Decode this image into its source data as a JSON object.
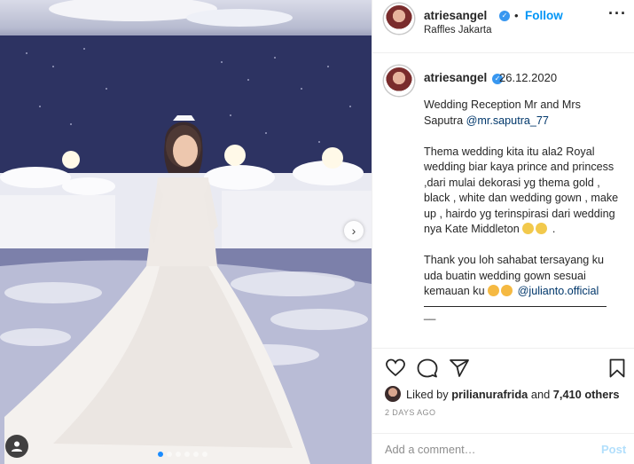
{
  "post": {
    "username": "atriesangel",
    "verified_mark": "✓",
    "follow_label": "Follow",
    "location": "Raffles Jakarta",
    "more_icon": "more-horizontal-icon"
  },
  "caption": {
    "username": "atriesangel",
    "date": "26.12.2020",
    "para1_text": "Wedding Reception Mr and Mrs Saputra ",
    "para1_mention": "@mr.saputra_77",
    "para2_text": "Thema wedding kita itu ala2 Royal wedding biar kaya prince and princess ,dari mulai dekorasi yg thema gold , black , white dan wedding gown , make up , hairdo yg terinspirasi dari wedding nya Kate Middleton ",
    "para2_tail": " .",
    "para3_text": "Thank you loh sahabat tersayang ku uda buatin wedding gown sesuai kemauan ku ",
    "para3_mention": "@julianto.official",
    "rule_tail": "__"
  },
  "actions": {
    "liked_prefix": "Liked by ",
    "liked_user": "prilianurafrida",
    "liked_mid": " and ",
    "liked_count": "7,410 others",
    "timestamp": "2 DAYS AGO"
  },
  "comment": {
    "placeholder": "Add a comment…",
    "post_label": "Post"
  },
  "carousel": {
    "slide_count": 6,
    "active_index": 0
  },
  "colors": {
    "link": "#0095f6",
    "mention": "#00376b",
    "verified": "#3897f0",
    "post_disabled": "#b2dffc"
  }
}
